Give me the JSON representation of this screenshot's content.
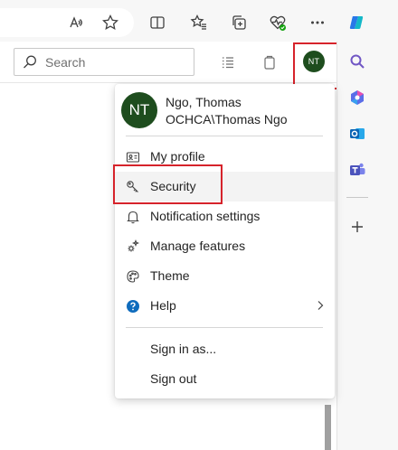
{
  "browser_toolbar": {
    "icons": [
      "read-aloud-icon",
      "favorite-star-icon",
      "split-screen-icon",
      "favorites-icon",
      "collections-icon",
      "browser-essentials-icon",
      "more-options-icon",
      "copilot-icon"
    ]
  },
  "app_header": {
    "search": {
      "placeholder": "Search",
      "value": ""
    },
    "icons": [
      "list-icon",
      "clipboard-icon"
    ],
    "avatar_initials": "NT"
  },
  "sidebar": {
    "icons": [
      "search-icon",
      "copilot-icon",
      "outlook-icon",
      "teams-icon",
      "add-icon"
    ]
  },
  "profile_menu": {
    "avatar_initials": "NT",
    "user_name": "Ngo, Thomas",
    "user_account": "OCHCA\\Thomas Ngo",
    "items": [
      {
        "label": "My profile",
        "icon": "contact-card-icon"
      },
      {
        "label": "Security",
        "icon": "key-icon"
      },
      {
        "label": "Notification settings",
        "icon": "bell-icon"
      },
      {
        "label": "Manage features",
        "icon": "sparkle-settings-icon"
      },
      {
        "label": "Theme",
        "icon": "palette-icon"
      },
      {
        "label": "Help",
        "icon": "help-icon"
      }
    ],
    "footer_items": [
      {
        "label": "Sign in as..."
      },
      {
        "label": "Sign out"
      }
    ]
  },
  "colors": {
    "avatar_bg": "#1e4d1e",
    "highlight_border": "#d6232b",
    "help_blue": "#0f6cbd"
  }
}
